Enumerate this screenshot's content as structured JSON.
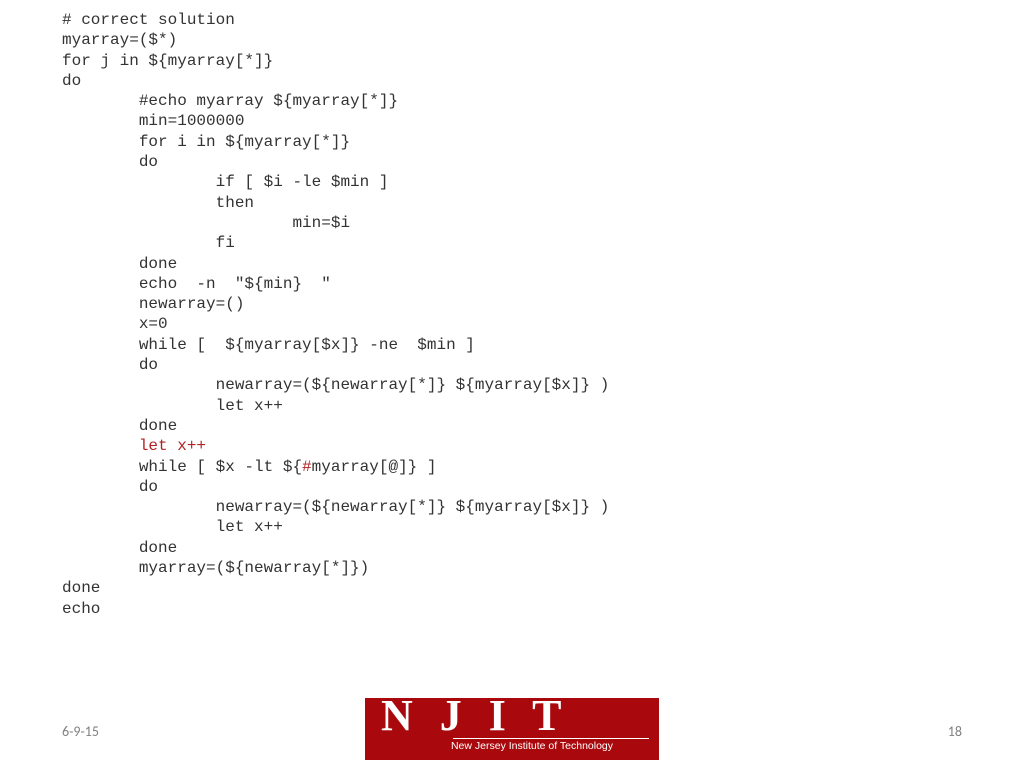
{
  "code": {
    "l1": "# correct solution",
    "l2": "myarray=($*)",
    "l3": "for j in ${myarray[*]}",
    "l4": "do",
    "l5": "        #echo myarray ${myarray[*]}",
    "l6": "        min=1000000",
    "l7": "        for i in ${myarray[*]}",
    "l8": "        do",
    "l9": "                if [ $i -le $min ]",
    "l10": "                then",
    "l11": "                        min=$i",
    "l12": "                fi",
    "l13": "        done",
    "l14": "        echo  -n  \"${min}  \"",
    "l15": "        newarray=()",
    "l16": "        x=0",
    "l17": "        while [  ${myarray[$x]} -ne  $min ]",
    "l18": "        do",
    "l19": "                newarray=(${newarray[*]} ${myarray[$x]} )",
    "l20": "                let x++",
    "l21": "        done",
    "l22a": "        ",
    "l22b": "let x++",
    "l23a": "        while [ $x -lt ${",
    "l23b": "#",
    "l23c": "myarray[@]} ]",
    "l24": "        do",
    "l25": "                newarray=(${newarray[*]} ${myarray[$x]} )",
    "l26": "                let x++",
    "l27": "        done",
    "l28": "        myarray=(${newarray[*]})",
    "l29": "done",
    "l30": "echo"
  },
  "footer": {
    "date": "6-9-15",
    "page": "18"
  },
  "logo": {
    "acronym": "N J I T",
    "fullname": "New Jersey Institute of Technology"
  }
}
